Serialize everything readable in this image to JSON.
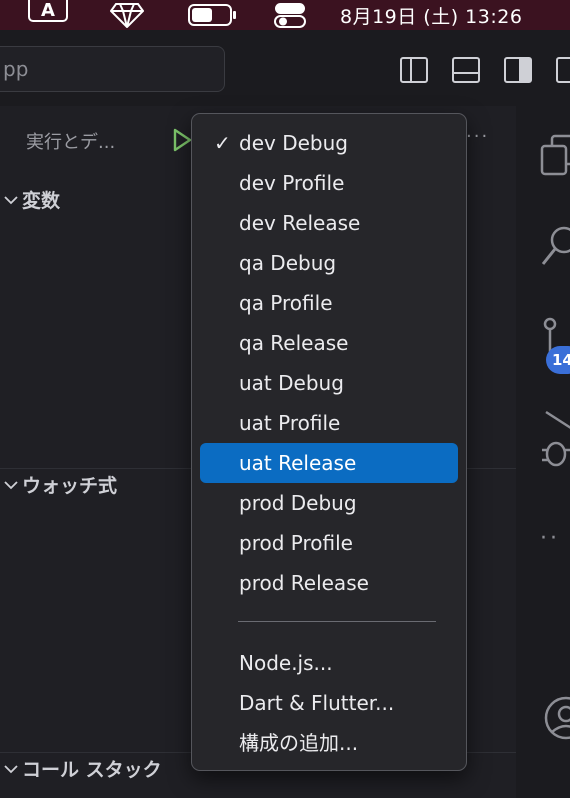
{
  "menubar": {
    "ime_label": "A",
    "clock": "8月19日 (土)  13:26"
  },
  "toolbar": {
    "search_value": "pp"
  },
  "sidebar": {
    "title": "実行とデ...",
    "more": "···",
    "sections": {
      "variables": "変数",
      "watch": "ウォッチ式",
      "callstack": "コール スタック"
    }
  },
  "activitybar": {
    "badge": "14"
  },
  "dropdown": {
    "checked_index": 0,
    "selected_index": 8,
    "options": [
      "dev Debug",
      "dev Profile",
      "dev Release",
      "qa Debug",
      "qa Profile",
      "qa Release",
      "uat Debug",
      "uat Profile",
      "uat Release",
      "prod Debug",
      "prod Profile",
      "prod Release"
    ],
    "separator": "",
    "extra_options": [
      "Node.js...",
      "Dart & Flutter...",
      "構成の追加..."
    ],
    "checkmark": "✓"
  },
  "colors": {
    "menubar_bg": "#3b1220",
    "selection": "#0b6cc2",
    "badge": "#3a6fd8",
    "play_green": "#7cc46a"
  }
}
